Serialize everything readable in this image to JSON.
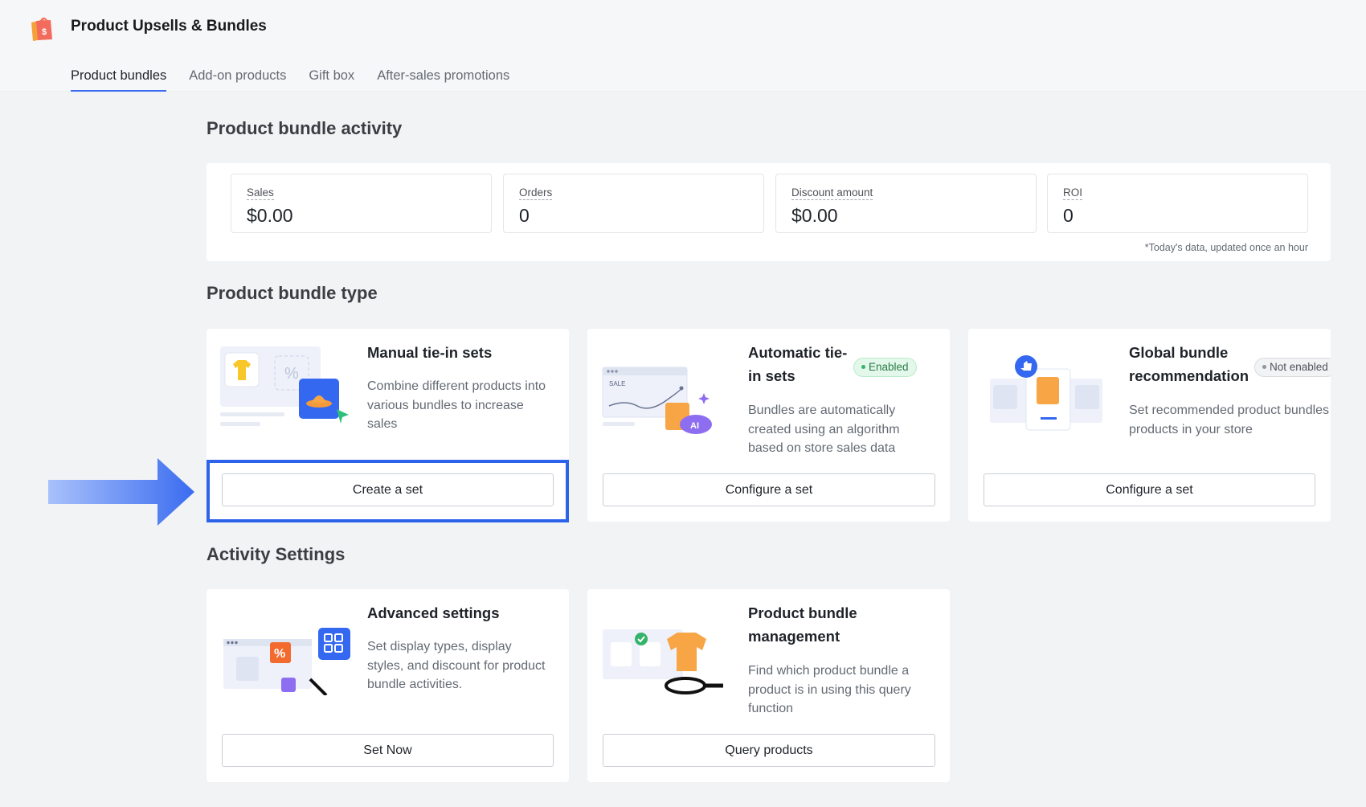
{
  "app": {
    "title": "Product Upsells & Bundles",
    "logo_icon": "shopping-bag-dollar-icon"
  },
  "tabs": [
    {
      "label": "Product bundles",
      "active": true
    },
    {
      "label": "Add-on products",
      "active": false
    },
    {
      "label": "Gift box",
      "active": false
    },
    {
      "label": "After-sales promotions",
      "active": false
    }
  ],
  "activity": {
    "title": "Product bundle activity",
    "stats": [
      {
        "label": "Sales",
        "value": "$0.00"
      },
      {
        "label": "Orders",
        "value": "0"
      },
      {
        "label": "Discount amount",
        "value": "$0.00"
      },
      {
        "label": "ROI",
        "value": "0"
      }
    ],
    "note": "*Today's data, updated once an hour"
  },
  "bundle_types": {
    "title": "Product bundle type",
    "cards": [
      {
        "title": "Manual tie-in sets",
        "description": "Combine different products into various bundles to increase sales",
        "button": "Create a set",
        "status": ""
      },
      {
        "title": "Automatic tie-in sets",
        "description": "Bundles are automatically created using an algorithm based on store sales data",
        "button": "Configure a set",
        "status": "Enabled"
      },
      {
        "title": "Global bundle recommendation",
        "description": "Set recommended product bundles for all products in your store",
        "button": "Configure a set",
        "status": "Not enabled"
      }
    ]
  },
  "settings": {
    "title": "Activity Settings",
    "cards": [
      {
        "title": "Advanced settings",
        "description": "Set display types, display styles, and discount for product bundle activities.",
        "button": "Set Now"
      },
      {
        "title": "Product bundle management",
        "description": "Find which product bundle a product is in using this query function",
        "button": "Query products"
      }
    ]
  },
  "colors": {
    "accent": "#3a6cf0",
    "highlight": "#2d63ea",
    "enabled_green": "#34b36a"
  }
}
